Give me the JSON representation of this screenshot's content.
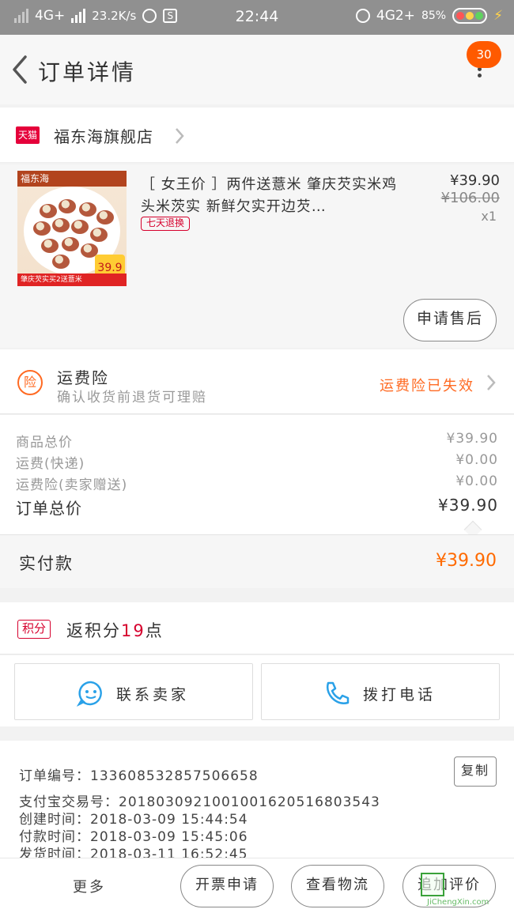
{
  "status_bar": {
    "network": "4G+",
    "speed": "23.2K/s",
    "sim_icon": "S",
    "time": "22:44",
    "network2": "4G2+",
    "battery": "85%"
  },
  "header": {
    "title": "订单详情",
    "badge": "30"
  },
  "shop": {
    "badge": "天猫",
    "name": "福东海旗舰店"
  },
  "item": {
    "image_top": "福东海",
    "image_price": "39.9",
    "image_bottom": "肇庆芡实买2送薏米",
    "title": "［ 女王价 ］两件送薏米 肇庆芡实米鸡头米茨实 新鲜欠实开边芡…",
    "tag": "七天退换",
    "price": "¥39.90",
    "original_price": "¥106.00",
    "quantity": "x1",
    "after_sale_button": "申请售后"
  },
  "insurance": {
    "icon": "险",
    "title": "运费险",
    "subtitle": "确认收货前退货可理赔",
    "status": "运费险已失效"
  },
  "totals": {
    "rows": [
      {
        "label": "商品总价",
        "value": "¥39.90"
      },
      {
        "label": "运费(快递)",
        "value": "¥0.00"
      },
      {
        "label": "运费险(卖家赠送)",
        "value": "¥0.00"
      }
    ],
    "order_total_label": "订单总价",
    "order_total_value": "¥39.90"
  },
  "payment": {
    "label": "实付款",
    "value": "¥39.90"
  },
  "points": {
    "tag": "积分",
    "prefix": "返积分",
    "count": "19",
    "suffix": "点"
  },
  "contact": {
    "seller_label": "联系卖家",
    "phone_label": "拨打电话"
  },
  "order_info": {
    "order_no": "订单编号：133608532857506658",
    "alipay_no": "支付宝交易号：2018030921001001620516803543",
    "created": "创建时间：2018-03-09  15:44:54",
    "paid": "付款时间：2018-03-09  15:45:06",
    "shipped": "发货时间：2018-03-11  16:52:45",
    "copy_button": "复制"
  },
  "bottom_bar": {
    "more": "更多",
    "invoice_button": "开票申请",
    "logistics_button": "查看物流",
    "review_button": "追加评价"
  },
  "watermark_text": "JiChengXin.com",
  "colors": {
    "accent_orange": "#ff6a00",
    "tmall_red": "#d6002d",
    "badge_orange": "#ff5a00"
  }
}
